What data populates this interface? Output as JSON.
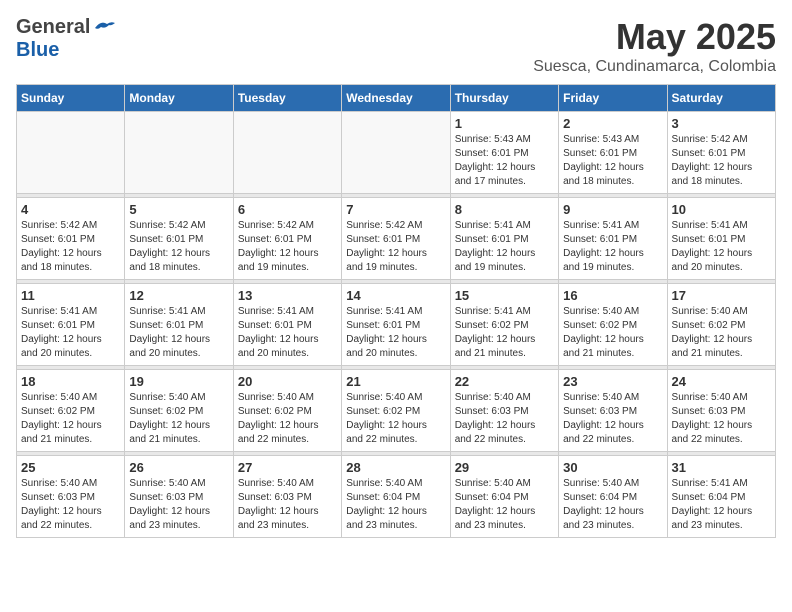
{
  "header": {
    "logo_general": "General",
    "logo_blue": "Blue",
    "month_title": "May 2025",
    "location": "Suesca, Cundinamarca, Colombia"
  },
  "weekdays": [
    "Sunday",
    "Monday",
    "Tuesday",
    "Wednesday",
    "Thursday",
    "Friday",
    "Saturday"
  ],
  "weeks": [
    [
      {
        "day": "",
        "info": ""
      },
      {
        "day": "",
        "info": ""
      },
      {
        "day": "",
        "info": ""
      },
      {
        "day": "",
        "info": ""
      },
      {
        "day": "1",
        "info": "Sunrise: 5:43 AM\nSunset: 6:01 PM\nDaylight: 12 hours\nand 17 minutes."
      },
      {
        "day": "2",
        "info": "Sunrise: 5:43 AM\nSunset: 6:01 PM\nDaylight: 12 hours\nand 18 minutes."
      },
      {
        "day": "3",
        "info": "Sunrise: 5:42 AM\nSunset: 6:01 PM\nDaylight: 12 hours\nand 18 minutes."
      }
    ],
    [
      {
        "day": "4",
        "info": "Sunrise: 5:42 AM\nSunset: 6:01 PM\nDaylight: 12 hours\nand 18 minutes."
      },
      {
        "day": "5",
        "info": "Sunrise: 5:42 AM\nSunset: 6:01 PM\nDaylight: 12 hours\nand 18 minutes."
      },
      {
        "day": "6",
        "info": "Sunrise: 5:42 AM\nSunset: 6:01 PM\nDaylight: 12 hours\nand 19 minutes."
      },
      {
        "day": "7",
        "info": "Sunrise: 5:42 AM\nSunset: 6:01 PM\nDaylight: 12 hours\nand 19 minutes."
      },
      {
        "day": "8",
        "info": "Sunrise: 5:41 AM\nSunset: 6:01 PM\nDaylight: 12 hours\nand 19 minutes."
      },
      {
        "day": "9",
        "info": "Sunrise: 5:41 AM\nSunset: 6:01 PM\nDaylight: 12 hours\nand 19 minutes."
      },
      {
        "day": "10",
        "info": "Sunrise: 5:41 AM\nSunset: 6:01 PM\nDaylight: 12 hours\nand 20 minutes."
      }
    ],
    [
      {
        "day": "11",
        "info": "Sunrise: 5:41 AM\nSunset: 6:01 PM\nDaylight: 12 hours\nand 20 minutes."
      },
      {
        "day": "12",
        "info": "Sunrise: 5:41 AM\nSunset: 6:01 PM\nDaylight: 12 hours\nand 20 minutes."
      },
      {
        "day": "13",
        "info": "Sunrise: 5:41 AM\nSunset: 6:01 PM\nDaylight: 12 hours\nand 20 minutes."
      },
      {
        "day": "14",
        "info": "Sunrise: 5:41 AM\nSunset: 6:01 PM\nDaylight: 12 hours\nand 20 minutes."
      },
      {
        "day": "15",
        "info": "Sunrise: 5:41 AM\nSunset: 6:02 PM\nDaylight: 12 hours\nand 21 minutes."
      },
      {
        "day": "16",
        "info": "Sunrise: 5:40 AM\nSunset: 6:02 PM\nDaylight: 12 hours\nand 21 minutes."
      },
      {
        "day": "17",
        "info": "Sunrise: 5:40 AM\nSunset: 6:02 PM\nDaylight: 12 hours\nand 21 minutes."
      }
    ],
    [
      {
        "day": "18",
        "info": "Sunrise: 5:40 AM\nSunset: 6:02 PM\nDaylight: 12 hours\nand 21 minutes."
      },
      {
        "day": "19",
        "info": "Sunrise: 5:40 AM\nSunset: 6:02 PM\nDaylight: 12 hours\nand 21 minutes."
      },
      {
        "day": "20",
        "info": "Sunrise: 5:40 AM\nSunset: 6:02 PM\nDaylight: 12 hours\nand 22 minutes."
      },
      {
        "day": "21",
        "info": "Sunrise: 5:40 AM\nSunset: 6:02 PM\nDaylight: 12 hours\nand 22 minutes."
      },
      {
        "day": "22",
        "info": "Sunrise: 5:40 AM\nSunset: 6:03 PM\nDaylight: 12 hours\nand 22 minutes."
      },
      {
        "day": "23",
        "info": "Sunrise: 5:40 AM\nSunset: 6:03 PM\nDaylight: 12 hours\nand 22 minutes."
      },
      {
        "day": "24",
        "info": "Sunrise: 5:40 AM\nSunset: 6:03 PM\nDaylight: 12 hours\nand 22 minutes."
      }
    ],
    [
      {
        "day": "25",
        "info": "Sunrise: 5:40 AM\nSunset: 6:03 PM\nDaylight: 12 hours\nand 22 minutes."
      },
      {
        "day": "26",
        "info": "Sunrise: 5:40 AM\nSunset: 6:03 PM\nDaylight: 12 hours\nand 23 minutes."
      },
      {
        "day": "27",
        "info": "Sunrise: 5:40 AM\nSunset: 6:03 PM\nDaylight: 12 hours\nand 23 minutes."
      },
      {
        "day": "28",
        "info": "Sunrise: 5:40 AM\nSunset: 6:04 PM\nDaylight: 12 hours\nand 23 minutes."
      },
      {
        "day": "29",
        "info": "Sunrise: 5:40 AM\nSunset: 6:04 PM\nDaylight: 12 hours\nand 23 minutes."
      },
      {
        "day": "30",
        "info": "Sunrise: 5:40 AM\nSunset: 6:04 PM\nDaylight: 12 hours\nand 23 minutes."
      },
      {
        "day": "31",
        "info": "Sunrise: 5:41 AM\nSunset: 6:04 PM\nDaylight: 12 hours\nand 23 minutes."
      }
    ]
  ]
}
